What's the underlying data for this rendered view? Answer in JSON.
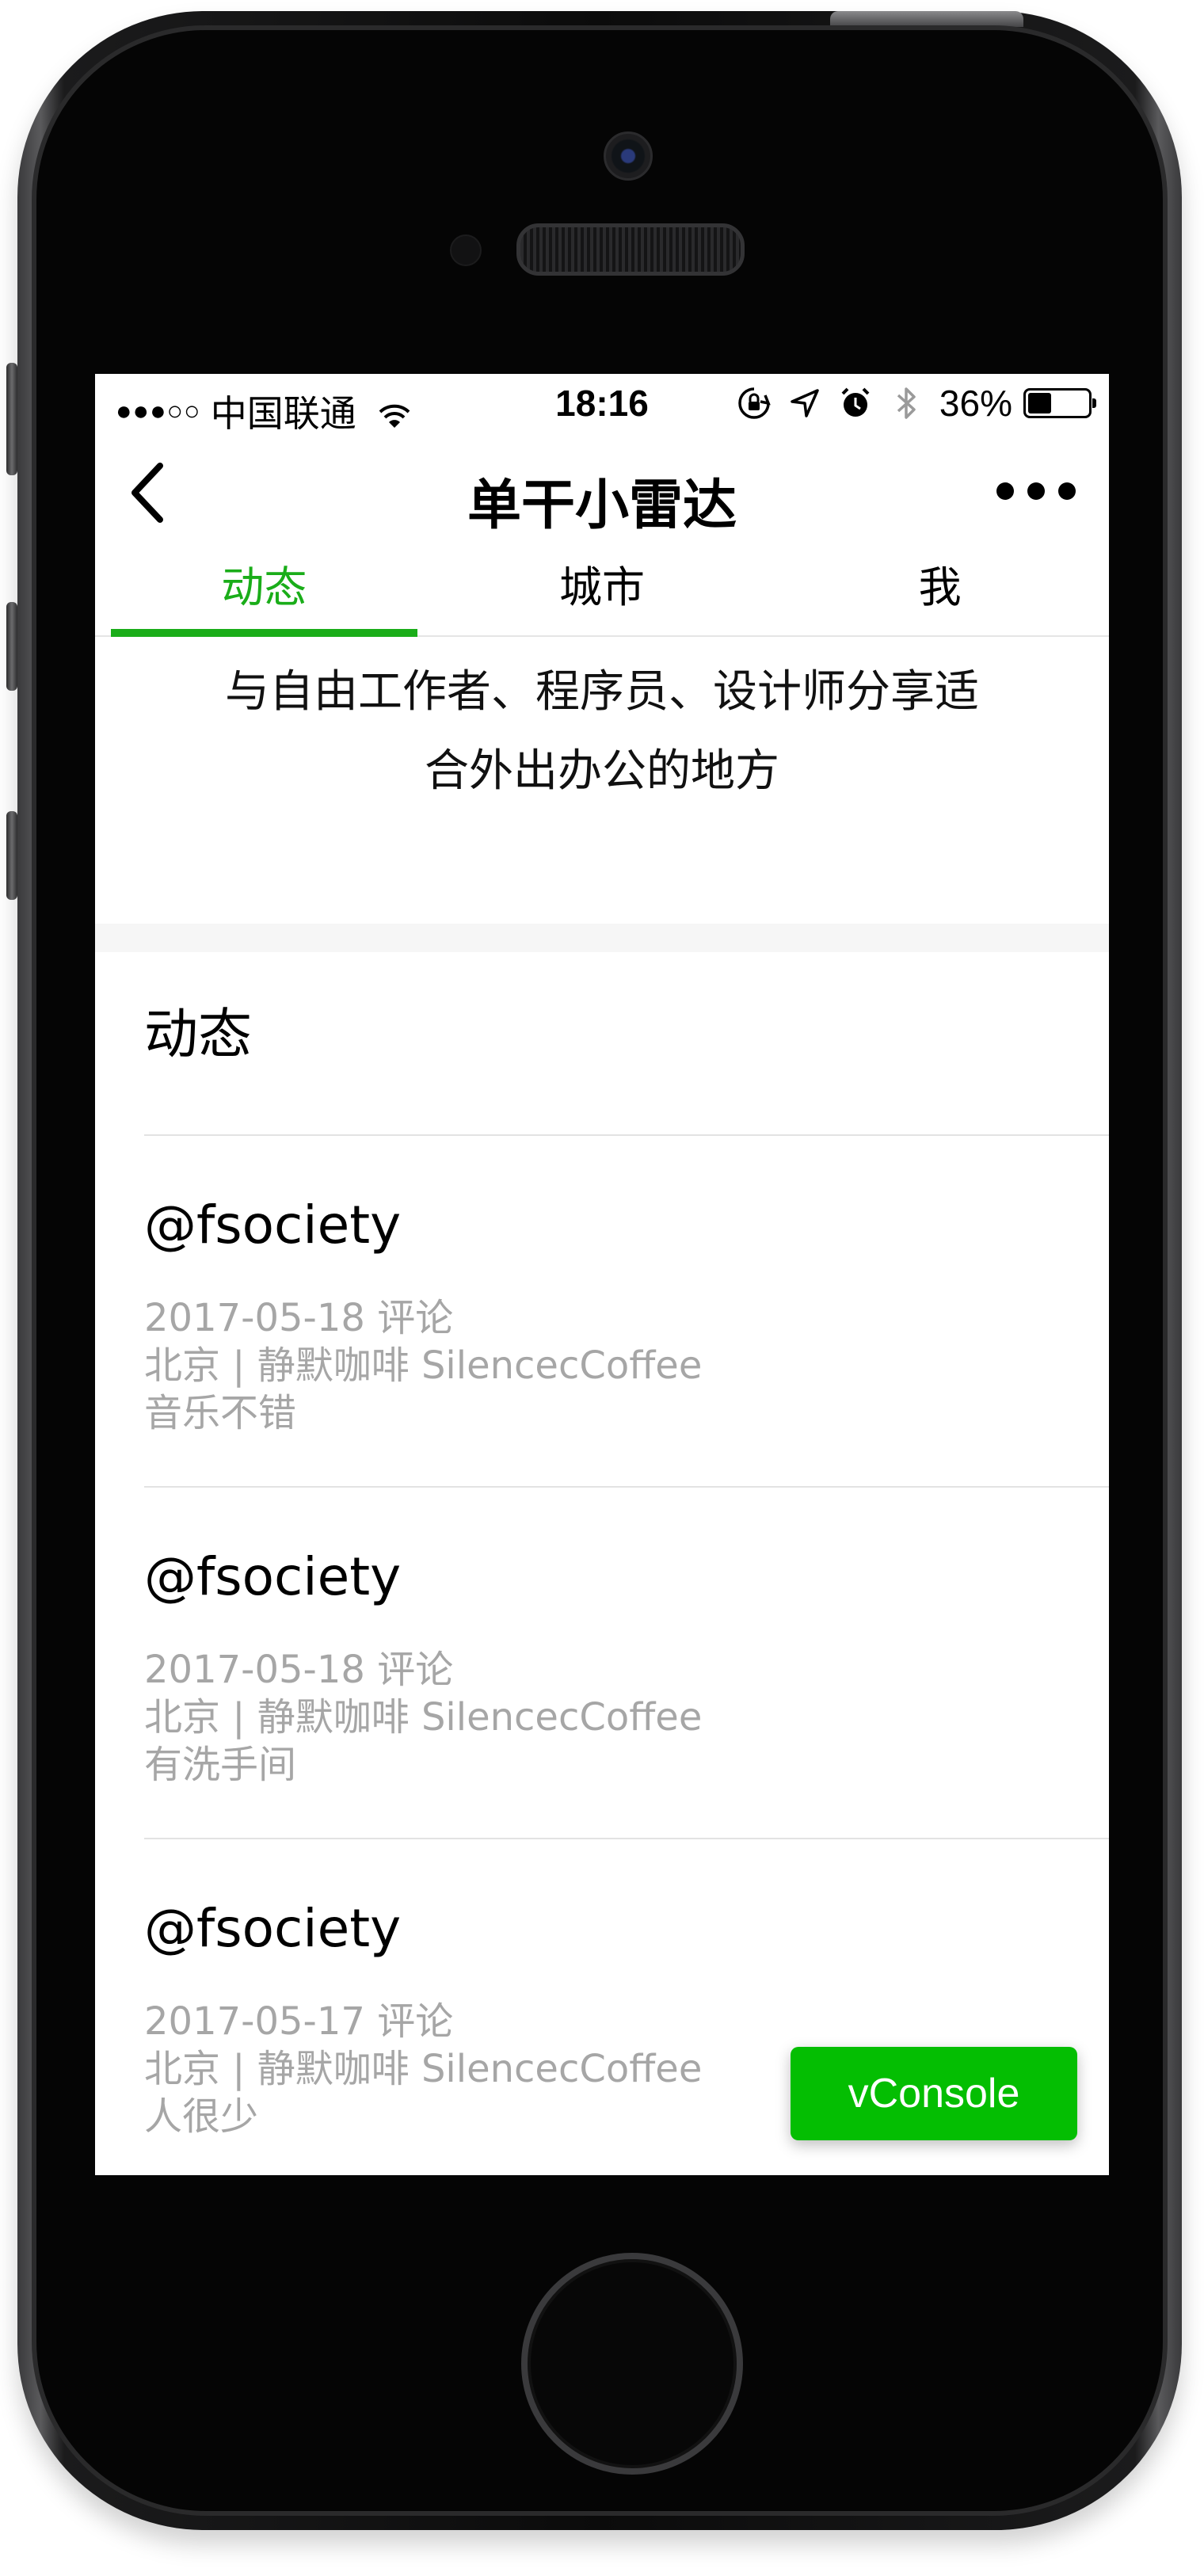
{
  "status_bar": {
    "signal": "●●●○○",
    "carrier": "中国联通",
    "time": "18:16",
    "battery_text": "36%",
    "battery_level": 0.36
  },
  "nav": {
    "title": "单干小雷达"
  },
  "tabs": [
    {
      "label": "动态",
      "active": true
    },
    {
      "label": "城市",
      "active": false
    },
    {
      "label": "我",
      "active": false
    }
  ],
  "slogan": {
    "line1": "与自由工作者、程序员、设计师分享适",
    "line2": "合外出办公的地方"
  },
  "section": {
    "title": "动态"
  },
  "feed": [
    {
      "user": "@fsociety",
      "date_action": "2017-05-18 评论",
      "place": "北京 | 静默咖啡 SilencecCoffee",
      "comment": "音乐不错"
    },
    {
      "user": "@fsociety",
      "date_action": "2017-05-18 评论",
      "place": "北京 | 静默咖啡 SilencecCoffee",
      "comment": "有洗手间"
    },
    {
      "user": "@fsociety",
      "date_action": "2017-05-17 评论",
      "place": "北京 | 静默咖啡 SilencecCoffee",
      "comment": "人很少"
    }
  ],
  "vconsole": {
    "label": "vConsole"
  },
  "colors": {
    "accent": "#1aad19",
    "vconsole": "#04be02",
    "meta_text": "#a6a6a6"
  },
  "icons": {
    "status_left": [
      "wifi-icon"
    ],
    "status_right": [
      "orientation-lock-icon",
      "location-arrow-icon",
      "alarm-icon",
      "bluetooth-icon"
    ],
    "nav": [
      "back-chevron-icon",
      "more-dots-icon"
    ]
  }
}
